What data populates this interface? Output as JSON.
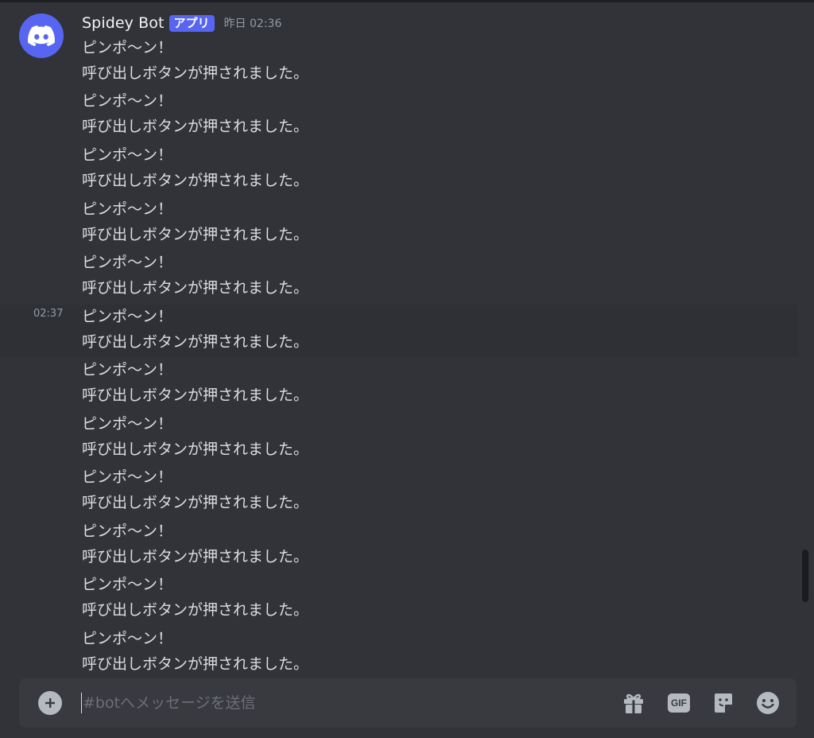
{
  "group": {
    "author": "Spidey Bot",
    "badge": "アプリ",
    "timestamp": "昨日 02:36"
  },
  "messages": [
    {
      "line1": "ピンポ〜ン！",
      "line2": "呼び出しボタンが押されました。"
    },
    {
      "line1": "ピンポ〜ン！",
      "line2": "呼び出しボタンが押されました。"
    },
    {
      "line1": "ピンポ〜ン！",
      "line2": "呼び出しボタンが押されました。"
    },
    {
      "line1": "ピンポ〜ン！",
      "line2": "呼び出しボタンが押されました。"
    },
    {
      "line1": "ピンポ〜ン！",
      "line2": "呼び出しボタンが押されました。"
    },
    {
      "line1": "ピンポ〜ン！",
      "line2": "呼び出しボタンが押されました。",
      "hover_time": "02:37"
    },
    {
      "line1": "ピンポ〜ン！",
      "line2": "呼び出しボタンが押されました。"
    },
    {
      "line1": "ピンポ〜ン！",
      "line2": "呼び出しボタンが押されました。"
    },
    {
      "line1": "ピンポ〜ン！",
      "line2": "呼び出しボタンが押されました。"
    },
    {
      "line1": "ピンポ〜ン！",
      "line2": "呼び出しボタンが押されました。"
    },
    {
      "line1": "ピンポ〜ン！",
      "line2": "呼び出しボタンが押されました。"
    },
    {
      "line1": "ピンポ〜ン！",
      "line2": "呼び出しボタンが押されました。"
    }
  ],
  "composer": {
    "placeholder": "#botへメッセージを送信",
    "gif_label": "GIF"
  },
  "icons": {
    "avatar": "discord-logo-icon",
    "attach": "plus-circle-icon",
    "gift": "gift-icon",
    "gif": "gif-icon",
    "sticker": "sticker-icon",
    "emoji": "emoji-icon"
  },
  "colors": {
    "background": "#313338",
    "brand": "#5865f2",
    "composer": "#383a40",
    "text": "#dbdee1",
    "muted": "#949ba4"
  }
}
